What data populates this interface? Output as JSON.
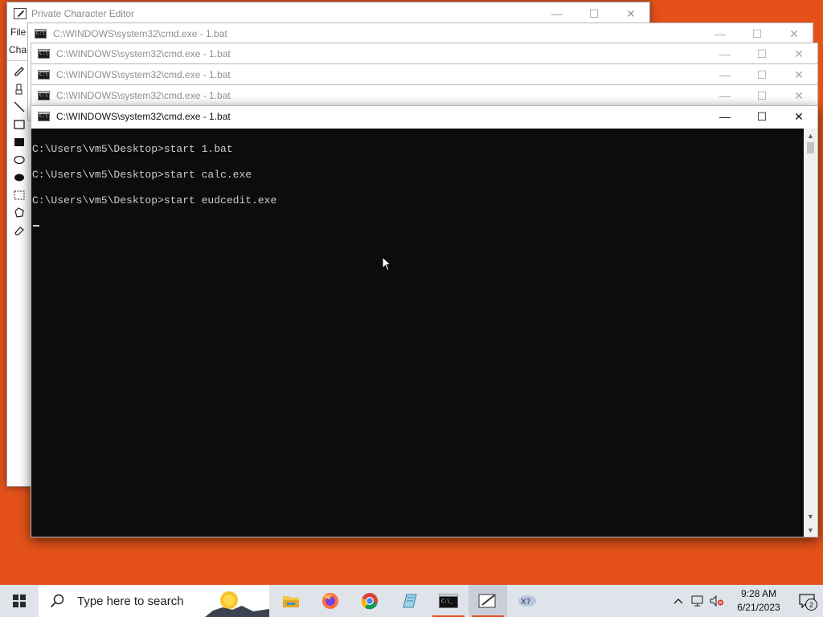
{
  "private_editor": {
    "title": "Private Character Editor",
    "menu_partial": "File",
    "menu2_partial": "Char",
    "tools": [
      "pencil-icon",
      "brush-icon",
      "line-icon",
      "hollow-rect-icon",
      "filled-rect-icon",
      "hollow-ellipse-icon",
      "filled-ellipse-icon",
      "rect-select-icon",
      "freeform-select-icon",
      "eraser-icon"
    ]
  },
  "cmd_windows": [
    {
      "title": "C:\\WINDOWS\\system32\\cmd.exe - 1.bat"
    },
    {
      "title": "C:\\WINDOWS\\system32\\cmd.exe - 1.bat"
    },
    {
      "title": "C:\\WINDOWS\\system32\\cmd.exe - 1.bat"
    },
    {
      "title": "C:\\WINDOWS\\system32\\cmd.exe - 1.bat"
    }
  ],
  "active_cmd": {
    "title": "C:\\WINDOWS\\system32\\cmd.exe - 1.bat",
    "lines": [
      "C:\\Users\\vm5\\Desktop>start 1.bat",
      "C:\\Users\\vm5\\Desktop>start calc.exe",
      "C:\\Users\\vm5\\Desktop>start eudcedit.exe"
    ]
  },
  "taskbar": {
    "search_placeholder": "Type here to search",
    "apps": [
      "file-explorer-icon",
      "firefox-icon",
      "chrome-icon",
      "notepad-icon",
      "cmd-icon",
      "private-char-editor-icon",
      "app-icon"
    ],
    "clock_time": "9:28 AM",
    "clock_date": "6/21/2023",
    "notification_count": "2"
  },
  "colors": {
    "desktop": "#e4521a",
    "console_bg": "#0c0c0c",
    "console_fg": "#cccccc",
    "taskbar": "#dfe3ea"
  }
}
